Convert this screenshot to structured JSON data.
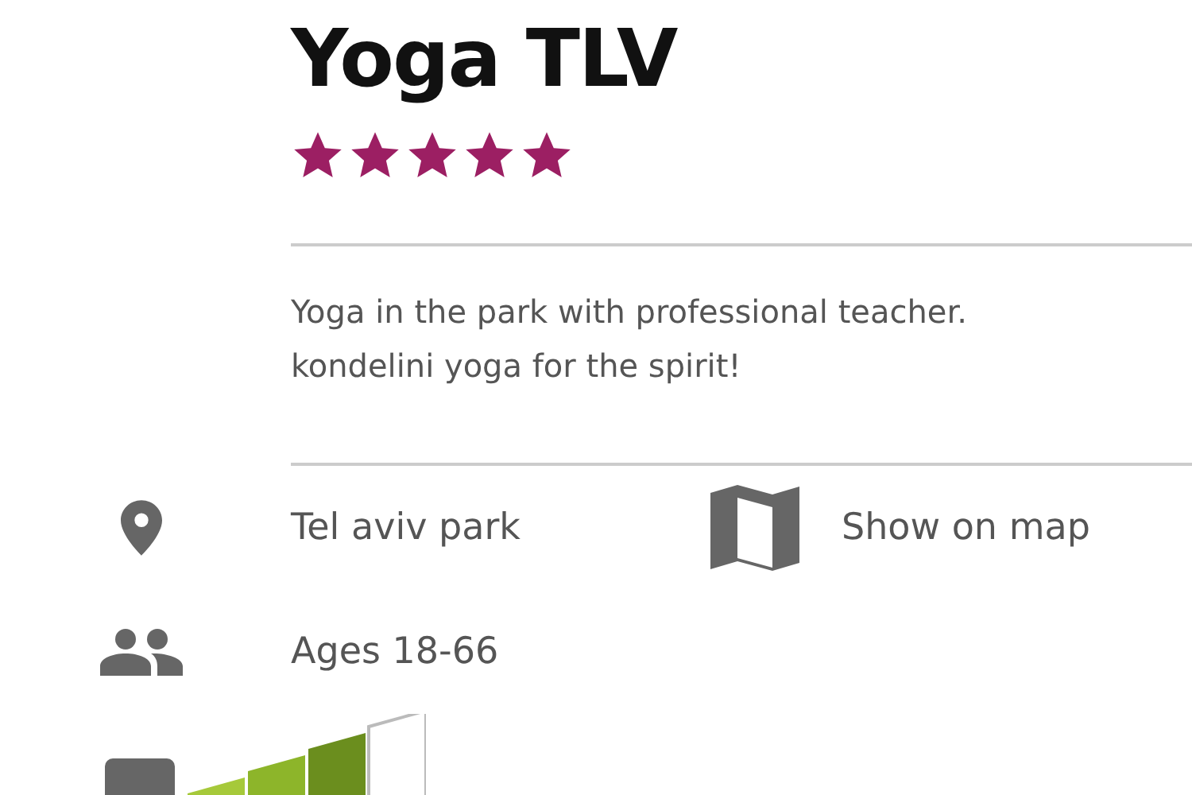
{
  "title": "Yoga TLV",
  "stars": 5,
  "description": "Yoga in the park with professional teacher. kondelini yoga for the spirit!",
  "location": "Tel aviv park",
  "map_link": "Show on map",
  "ages": "Ages 18-66",
  "difficulty": {
    "level": 0.75
  }
}
